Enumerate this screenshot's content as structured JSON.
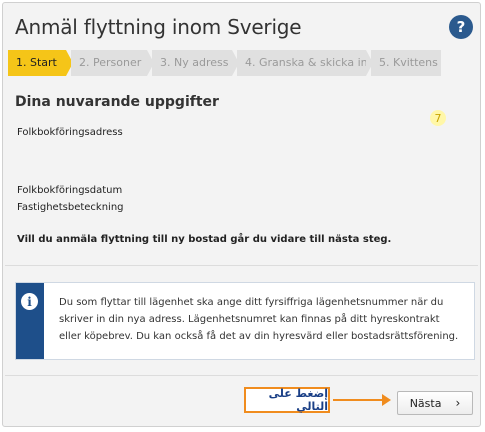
{
  "header": {
    "title": "Anmäl flyttning inom Sverige",
    "help_icon": "question-icon",
    "help_symbol": "?"
  },
  "steps": [
    {
      "label": "1. Start",
      "active": true
    },
    {
      "label": "2. Personer",
      "active": false
    },
    {
      "label": "3. Ny adress",
      "active": false
    },
    {
      "label": "4. Granska & skicka in",
      "active": false
    },
    {
      "label": "5. Kvittens",
      "active": false
    }
  ],
  "main": {
    "section_title": "Dina nuvarande uppgifter",
    "badge": "7",
    "fields": {
      "folkbokforingsadress": "Folkbokföringsadress",
      "folkbokforingsdatum": "Folkbokföringsdatum",
      "fastighetsbeteckning": "Fastighetsbeteckning"
    },
    "instruction": "Vill du anmäla flyttning till ny bostad går du vidare till nästa steg."
  },
  "infobox": {
    "icon": "info-icon",
    "icon_symbol": "i",
    "text": "Du som flyttar till lägenhet ska ange ditt fyrsiffriga lägenhetsnummer när du skriver in din nya adress. Lägenhetsnumret kan finnas på ditt hyreskontrakt eller köpebrev. Du kan också få det av din hyresvärd eller bostadsrättsförening."
  },
  "footer": {
    "annotation": "إضغط على التالي",
    "next_label": "Nästa",
    "next_icon": "chevron-right-icon",
    "next_symbol": "›"
  },
  "colors": {
    "accent": "#f5c518",
    "brand": "#1e4f8a",
    "annotation": "#f08c1e"
  }
}
